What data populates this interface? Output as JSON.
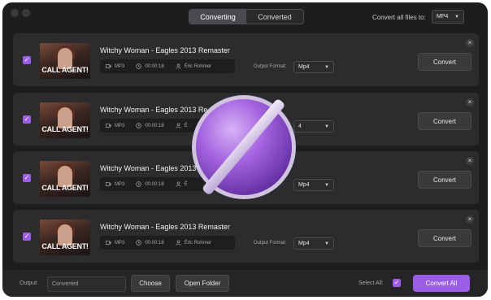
{
  "header": {
    "tabs": [
      {
        "label": "Converting",
        "active": true
      },
      {
        "label": "Converted",
        "active": false
      }
    ],
    "convert_all_files_label": "Convert all files to:",
    "convert_all_format": "MP4"
  },
  "items": [
    {
      "title": "Witchy Woman - Eagles 2013 Remaster",
      "format": "MP3",
      "duration": "00:00:18",
      "artist": "Éric Rohmer",
      "output_format_label": "Output Format:",
      "output_format": "Mp4",
      "convert_label": "Convert",
      "checked": true,
      "thumb_caption": "CALL AGENT!"
    },
    {
      "title": "Witchy Woman - Eagles 2013 Re",
      "format": "MP3",
      "duration": "00:00:18",
      "artist": "É",
      "output_format_label": "",
      "output_format": "4",
      "convert_label": "Convert",
      "checked": true,
      "thumb_caption": "CALL AGENT!"
    },
    {
      "title": "Witchy Woman - Eagles 2013",
      "format": "MP3",
      "duration": "00:00:18",
      "artist": "É",
      "output_format_label": "",
      "output_format": "Mp4",
      "convert_label": "Convert",
      "checked": true,
      "thumb_caption": "CALL AGENT!"
    },
    {
      "title": "Witchy Woman - Eagles 2013 Remaster",
      "format": "MP3",
      "duration": "00:00:18",
      "artist": "Éric Rohmer",
      "output_format_label": "Output Format:",
      "output_format": "Mp4",
      "convert_label": "Convert",
      "checked": true,
      "thumb_caption": "CALL AGENT!"
    }
  ],
  "footer": {
    "output_label": "Output:",
    "output_path": "Converted",
    "choose_label": "Choose",
    "open_folder_label": "Open Folder",
    "select_all_label": "Select All:",
    "convert_all_label": "Convert All"
  },
  "colors": {
    "accent": "#9b5de5",
    "background": "#1d1d1f",
    "card": "#2c2c2e"
  }
}
